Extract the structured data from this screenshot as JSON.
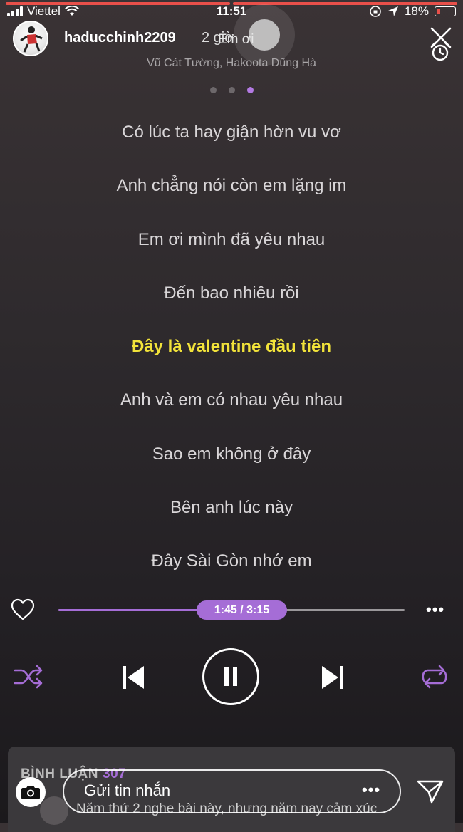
{
  "status": {
    "carrier": "Viettel",
    "time": "11:51",
    "battery": "18%"
  },
  "story": {
    "username": "haducchinh2209",
    "time_ago": "2 giờ"
  },
  "song": {
    "title_visible": "Em ơi",
    "artist": "Vũ Cát Tường, Hakoota Dũng Hà"
  },
  "lyrics": [
    "Có lúc ta hay giận hờn vu vơ",
    "Anh chẳng nói còn em lặng im",
    "Em ơi mình đã yêu nhau",
    "Đến bao nhiêu rồi",
    "Đây là valentine đầu tiên",
    "Anh và em có nhau yêu nhau",
    "Sao em không ở đây",
    "Bên anh lúc này",
    "Đây Sài Gòn nhớ em"
  ],
  "current_lyric_index": 4,
  "player": {
    "time": "1:45 / 3:15",
    "progress": 0.54
  },
  "comments": {
    "heading": "BÌNH LUẬN",
    "count": "307",
    "preview": "Năm thứ 2 nghe bài này, nhưng năm nay cảm xúc"
  },
  "reply": {
    "placeholder": "Gửi tin nhắn"
  },
  "colors": {
    "accent": "#a56dd6",
    "highlight": "#f2e33a",
    "story_bar": "#e8504a"
  }
}
